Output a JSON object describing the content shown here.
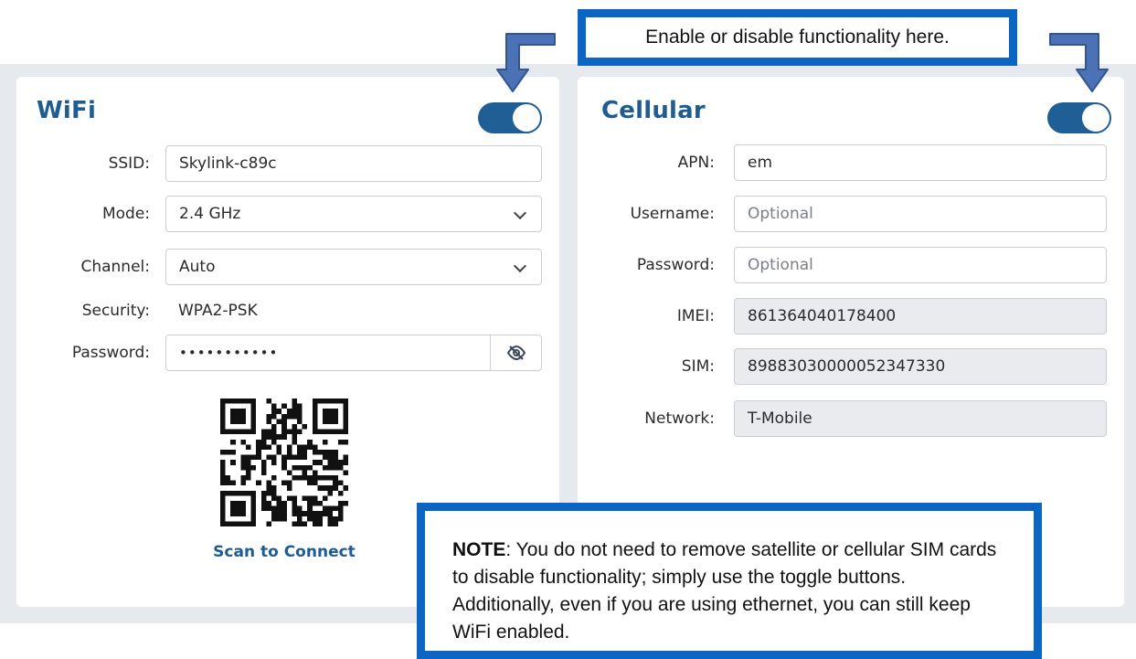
{
  "callouts": {
    "top": "Enable or disable functionality here.",
    "note_label": "NOTE",
    "note_text": ": You do not need to remove satellite or cellular SIM cards to disable functionality; simply use the toggle buttons. Additionally, even if you are using ethernet, you can still keep WiFi enabled."
  },
  "wifi": {
    "title": "WiFi",
    "toggle_on": true,
    "ssid_label": "SSID:",
    "ssid_value": "Skylink-c89c",
    "mode_label": "Mode:",
    "mode_value": "2.4 GHz",
    "channel_label": "Channel:",
    "channel_value": "Auto",
    "security_label": "Security:",
    "security_value": "WPA2-PSK",
    "password_label": "Password:",
    "password_value": "•••••••••••",
    "scan_label": "Scan to Connect"
  },
  "cellular": {
    "title": "Cellular",
    "toggle_on": true,
    "apn_label": "APN:",
    "apn_value": "em",
    "username_label": "Username:",
    "username_placeholder": "Optional",
    "password_label": "Password:",
    "password_placeholder": "Optional",
    "imei_label": "IMEI:",
    "imei_value": "861364040178400",
    "sim_label": "SIM:",
    "sim_value": "89883030000052347330",
    "network_label": "Network:",
    "network_value": "T-Mobile"
  },
  "colors": {
    "accent": "#1e5c92",
    "toggle": "#1f5f96",
    "callout_border": "#0b66c3",
    "arrow": "#4a72b5"
  },
  "icons": {
    "password_visibility": "eye-slash-icon",
    "qr": "qr-code-icon",
    "pointer": "down-arrow-icon"
  }
}
